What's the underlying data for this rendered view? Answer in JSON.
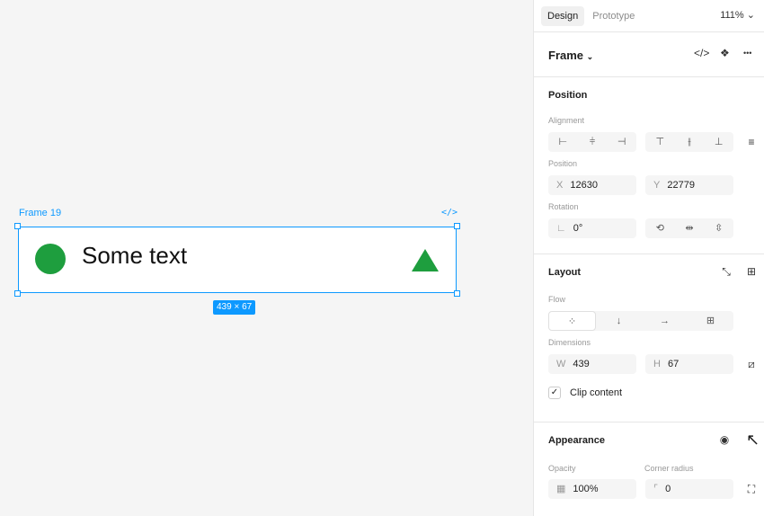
{
  "canvas": {
    "frame_name": "Frame 19",
    "code_badge": "</>",
    "frame_text": "Some text",
    "dimensions_badge": "439 × 67",
    "accent_color": "#0d99ff",
    "shape_color": "#1e9e3e"
  },
  "tabs": {
    "design": "Design",
    "prototype": "Prototype",
    "zoom": "111%"
  },
  "frame_header": {
    "title": "Frame",
    "code_icon": "</>",
    "component_icon": "❖",
    "more_icon": "•••"
  },
  "position": {
    "title": "Position",
    "alignment_label": "Alignment",
    "position_label": "Position",
    "x_prefix": "X",
    "x_value": "12630",
    "y_prefix": "Y",
    "y_value": "22779",
    "rotation_label": "Rotation",
    "rotation_prefix": "∟",
    "rotation_value": "0°"
  },
  "layout": {
    "title": "Layout",
    "flow_label": "Flow",
    "dimensions_label": "Dimensions",
    "w_prefix": "W",
    "w_value": "439",
    "h_prefix": "H",
    "h_value": "67",
    "clip_check": "✓",
    "clip_label": "Clip content"
  },
  "appearance": {
    "title": "Appearance",
    "opacity_label": "Opacity",
    "opacity_value": "100%",
    "radius_label": "Corner radius",
    "radius_value": "0"
  }
}
